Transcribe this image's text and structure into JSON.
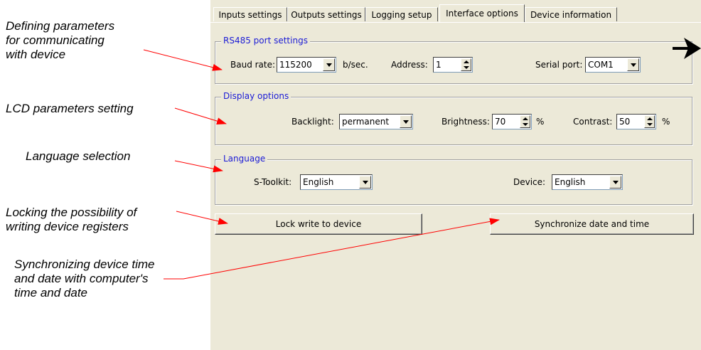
{
  "annotations": [
    {
      "line1": "Defining parameters",
      "line2": "for communicating",
      "line3": "with device"
    },
    {
      "line1": "LCD parameters setting"
    },
    {
      "line1": "Language selection"
    },
    {
      "line1": "Locking the possibility of",
      "line2": "writing device registers"
    },
    {
      "line1": "Synchronizing device time",
      "line2": "and date with computer's",
      "line3": "time and date"
    }
  ],
  "tabs": [
    "Inputs settings",
    "Outputs settings",
    "Logging setup",
    "Interface options",
    "Device information"
  ],
  "active_tab": "Interface options",
  "rs485": {
    "title": "RS485 port settings",
    "baud_label": "Baud rate:",
    "baud_value": "115200",
    "baud_unit": "b/sec.",
    "address_label": "Address:",
    "address_value": "1",
    "serial_label": "Serial port:",
    "serial_value": "COM1"
  },
  "display": {
    "title": "Display options",
    "backlight_label": "Backlight:",
    "backlight_value": "permanent",
    "brightness_label": "Brightness:",
    "brightness_value": "70",
    "brightness_unit": "%",
    "contrast_label": "Contrast:",
    "contrast_value": "50",
    "contrast_unit": "%"
  },
  "language": {
    "title": "Language",
    "toolkit_label": "S-Toolkit:",
    "toolkit_value": "English",
    "device_label": "Device:",
    "device_value": "English"
  },
  "buttons": {
    "lock": "Lock write to device",
    "sync": "Synchronize date and time"
  },
  "colors": {
    "arrow": "#ff0000",
    "legend": "#1b1bd6",
    "panel": "#ece9d8"
  }
}
